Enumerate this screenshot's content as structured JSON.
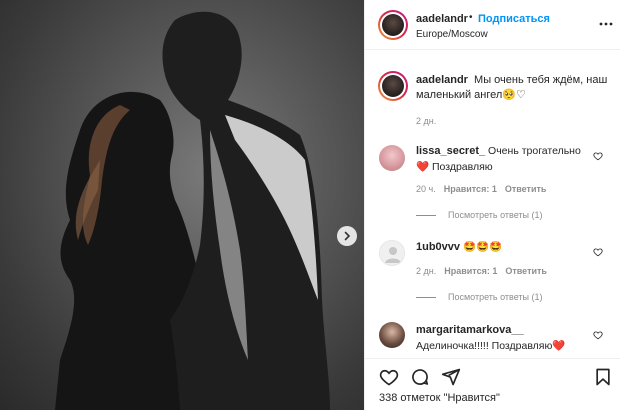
{
  "post": {
    "author": "aadelandr",
    "follow_label": "Подписаться",
    "separator": "•",
    "location": "Europe/Moscow",
    "caption_text": "Мы очень тебя ждём, наш маленький ангел",
    "caption_emoji": "🥺♡",
    "caption_time": "2 дн."
  },
  "comments": [
    {
      "user": "lissa_secret_",
      "text": "Очень трогательно",
      "text2": "❤️ Поздравляю",
      "time": "20 ч.",
      "likes": "Нравится: 1",
      "reply": "Ответить",
      "view_replies": "Посмотреть ответы (1)"
    },
    {
      "user": "1ub0vvv",
      "text": "🤩🤩🤩",
      "time": "2 дн.",
      "likes": "Нравится: 1",
      "reply": "Ответить",
      "view_replies": "Посмотреть ответы (1)"
    },
    {
      "user": "margaritamarkova__",
      "text": "Аделиночка!!!!! Поздравляю❤️"
    }
  ],
  "footer": {
    "likes_text": "338 отметок \"Нравится\""
  },
  "colors": {
    "accent_blue": "#0095f6",
    "muted": "#8e8e8e",
    "heart_red": "#ed4956"
  },
  "icons": [
    "heart-icon",
    "comment-icon",
    "share-icon",
    "bookmark-icon",
    "more-icon",
    "chevron-right-icon"
  ]
}
